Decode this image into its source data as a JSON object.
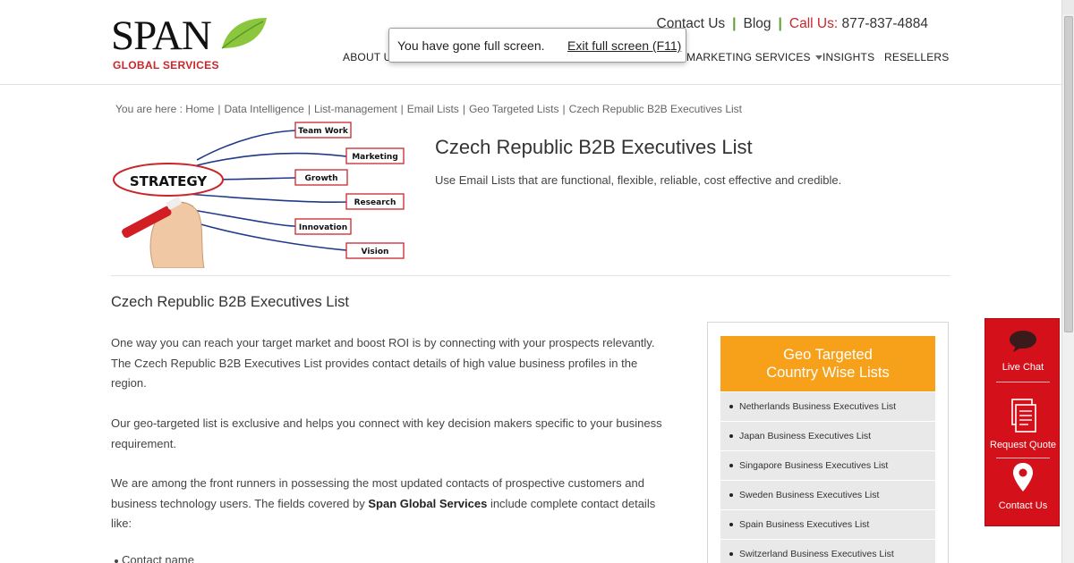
{
  "header": {
    "logo_text": "SPAN",
    "logo_sub": "GLOBAL SERVICES",
    "top_links": {
      "contact": "Contact Us",
      "blog": "Blog",
      "callus_label": "Call Us:",
      "phone": "877-837-4884"
    },
    "nav": {
      "about": "ABOUT US",
      "marketing": "MARKETING SERVICES",
      "insights": "INSIGHTS",
      "resellers": "RESELLERS"
    },
    "colors": {
      "brand_red": "#c8262b",
      "brand_green": "#5aa12c"
    }
  },
  "toast": {
    "message": "You have gone full screen.",
    "exit_label": "Exit full screen (F11)"
  },
  "breadcrumb": {
    "prefix": "You are here :",
    "items": [
      "Home",
      "Data Intelligence",
      "List-management",
      "Email Lists",
      "Geo Targeted Lists",
      "Czech Republic B2B Executives List"
    ]
  },
  "hero": {
    "title": "Czech Republic B2B Executives List",
    "subtitle": "Use Email Lists that are functional, flexible, reliable, cost effective and credible.",
    "image": {
      "center_label": "STRATEGY",
      "labels": [
        "Team Work",
        "Marketing",
        "Growth",
        "Research",
        "Innovation",
        "Vision"
      ]
    }
  },
  "content": {
    "heading": "Czech Republic B2B Executives List",
    "p1": "One way you can reach your target market and boost ROI is by connecting with your prospects relevantly. The Czech Republic B2B Executives List provides contact details of high value business profiles in the region.",
    "p2": "Our geo-targeted list is exclusive and helps you connect with key decision makers specific to your business requirement.",
    "p3_before": "We are among the front runners in possessing the most updated contacts of prospective customers and business technology users. The fields covered by ",
    "p3_bold": "Span Global Services",
    "p3_after": " include complete contact details like:",
    "bullet1": "Contact name"
  },
  "widget": {
    "title_line1": "Geo Targeted",
    "title_line2": "Country Wise Lists",
    "header_color": "#f7a11a",
    "items": [
      "Netherlands Business Executives List",
      "Japan Business Executives List",
      "Singapore Business Executives List",
      "Sweden Business Executives List",
      "Spain Business Executives List",
      "Switzerland Business Executives List"
    ]
  },
  "redbar": {
    "color": "#d4101a",
    "live_chat": "Live Chat",
    "request_quote": "Request Quote",
    "contact_us": "Contact Us"
  }
}
